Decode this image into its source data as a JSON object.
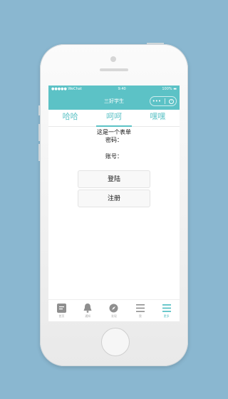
{
  "status": {
    "carrier": "●●●●● WeChat",
    "time": "9:40",
    "battery": "100%"
  },
  "nav": {
    "title": "三好学生",
    "menu_glyph": "•••"
  },
  "tabs": [
    {
      "label": "哈哈"
    },
    {
      "label": "呵呵"
    },
    {
      "label": "嘿嘿"
    }
  ],
  "content": {
    "form_title": "这是一个表单",
    "password_label": "密码：",
    "account_label": "账号：",
    "login_button": "登陆",
    "register_button": "注册"
  },
  "tabbar": [
    {
      "label": "首页",
      "icon": "document-icon"
    },
    {
      "label": "通知",
      "icon": "bell-icon"
    },
    {
      "label": "发现",
      "icon": "compass-icon"
    },
    {
      "label": "我",
      "icon": "list-icon"
    },
    {
      "label": "更多",
      "icon": "menu-icon"
    }
  ],
  "colors": {
    "accent": "#5cc2c6",
    "background": "#8ab7d0",
    "icon_gray": "#9a9a9a"
  }
}
